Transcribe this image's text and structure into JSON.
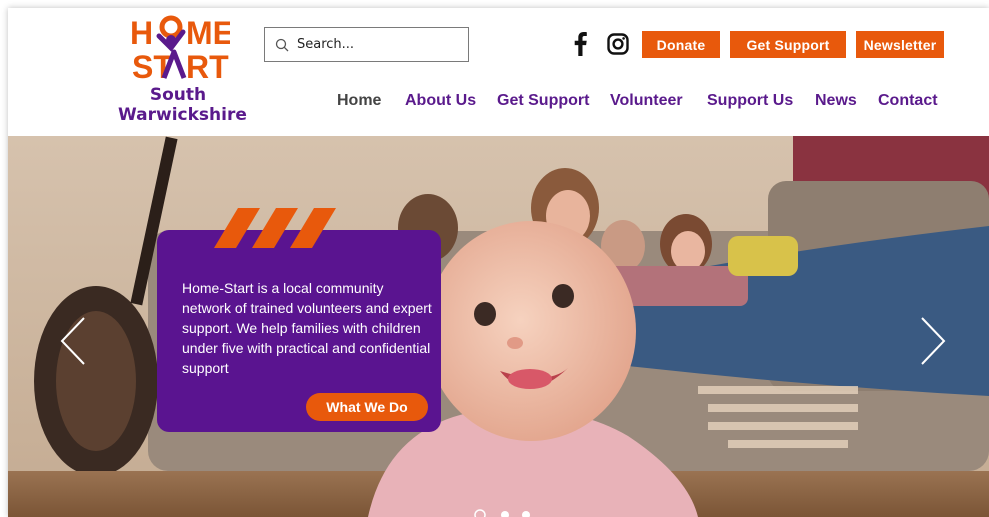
{
  "brand": {
    "logo_top": "HOME",
    "logo_bottom": "START",
    "line1": "South",
    "line2": "Warwickshire"
  },
  "search": {
    "placeholder": "Search..."
  },
  "social": {
    "facebook_icon": "facebook-icon",
    "instagram_icon": "instagram-icon"
  },
  "top_buttons": {
    "donate": "Donate",
    "get_support": "Get Support",
    "newsletter": "Newsletter"
  },
  "nav": {
    "items": [
      {
        "label": "Home"
      },
      {
        "label": "About Us"
      },
      {
        "label": "Get Support"
      },
      {
        "label": "Volunteer"
      },
      {
        "label": "Support Us"
      },
      {
        "label": "News"
      },
      {
        "label": "Contact"
      }
    ]
  },
  "hero": {
    "text": "Home-Start is a local community network of trained volunteers and expert support. We help families with children under five with practical and confidential support",
    "button": "What We Do",
    "slide_count": 3,
    "active_slide": 1
  },
  "colors": {
    "accent": "#e8590c",
    "brand": "#5a1a8c",
    "card": "#5a1490"
  }
}
